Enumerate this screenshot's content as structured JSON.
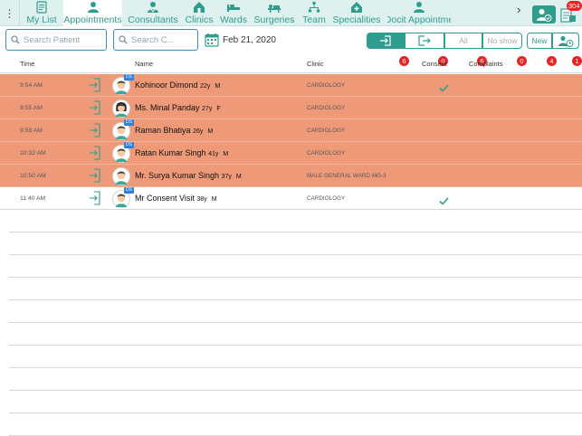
{
  "nav": {
    "tabs": [
      {
        "label": "My List",
        "icon": "my-list-icon"
      },
      {
        "label": "Appointments",
        "icon": "appointments-icon",
        "active": true
      },
      {
        "label": "Consultants",
        "icon": "consultants-icon"
      },
      {
        "label": "Clinics",
        "icon": "clinics-icon"
      },
      {
        "label": "Wards",
        "icon": "wards-icon"
      },
      {
        "label": "Surgeries",
        "icon": "surgeries-icon"
      },
      {
        "label": "Team",
        "icon": "team-icon"
      },
      {
        "label": "Specialities",
        "icon": "specialities-icon"
      },
      {
        "label": "Docit Appointme",
        "icon": "docit-appointments-icon"
      }
    ],
    "docs_badge": "304"
  },
  "toolbar": {
    "search_patient_placeholder": "Search Patient",
    "search_clinic_placeholder": "Search C...",
    "date": "Feb 21, 2020",
    "filters": [
      {
        "label": "",
        "icon": "check-in-icon",
        "badge": "6",
        "active": true
      },
      {
        "label": "",
        "icon": "check-out-icon",
        "badge": "0"
      },
      {
        "label": "All",
        "badge": "6"
      },
      {
        "label": "No show",
        "badge": "0"
      },
      {
        "label": "New",
        "badge": "4"
      },
      {
        "label": "",
        "icon": "patient-history-icon",
        "badge": "1"
      }
    ]
  },
  "table": {
    "headers": {
      "time": "Time",
      "name": "Name",
      "clinic": "Clinic",
      "consent": "Consent",
      "complaints": "Complaints"
    },
    "rows": [
      {
        "time": "9:54 AM",
        "name": "Kohinoor Dimond",
        "age": "22y",
        "sex": "M",
        "clinic": "CARDIOLOGY",
        "consent": true,
        "highlight": true,
        "ds": true,
        "avatar": "male"
      },
      {
        "time": "9:55 AM",
        "name": "Ms. Minal Panday",
        "age": "27y",
        "sex": "F",
        "clinic": "CARDIOLOGY",
        "consent": false,
        "highlight": true,
        "ds": false,
        "avatar": "female"
      },
      {
        "time": "9:59 AM",
        "name": "Raman Bhatiya",
        "age": "26y",
        "sex": "M",
        "clinic": "CARDIOLOGY",
        "consent": false,
        "highlight": true,
        "ds": true,
        "avatar": "male"
      },
      {
        "time": "10:32 AM",
        "name": "Ratan Kumar Singh",
        "age": "41y",
        "sex": "M",
        "clinic": "CARDIOLOGY",
        "consent": false,
        "highlight": true,
        "ds": true,
        "avatar": "male"
      },
      {
        "time": "10:50 AM",
        "name": "Mr. Surya Kumar Singh",
        "age": "37y",
        "sex": "M",
        "clinic": "MALE GENERAL WARD MG-3",
        "consent": false,
        "highlight": true,
        "ds": false,
        "avatar": "male"
      },
      {
        "time": "11:40 AM",
        "name": "Mr Consent Visit",
        "age": "38y",
        "sex": "M",
        "clinic": "CARDIOLOGY",
        "consent": true,
        "highlight": false,
        "ds": true,
        "avatar": "male"
      }
    ],
    "ds_label": "DS"
  },
  "colors": {
    "accent": "#2f9d8e",
    "highlight_row": "#ee9a78",
    "badge": "#e52525",
    "search_border": "#3d8fc4"
  }
}
